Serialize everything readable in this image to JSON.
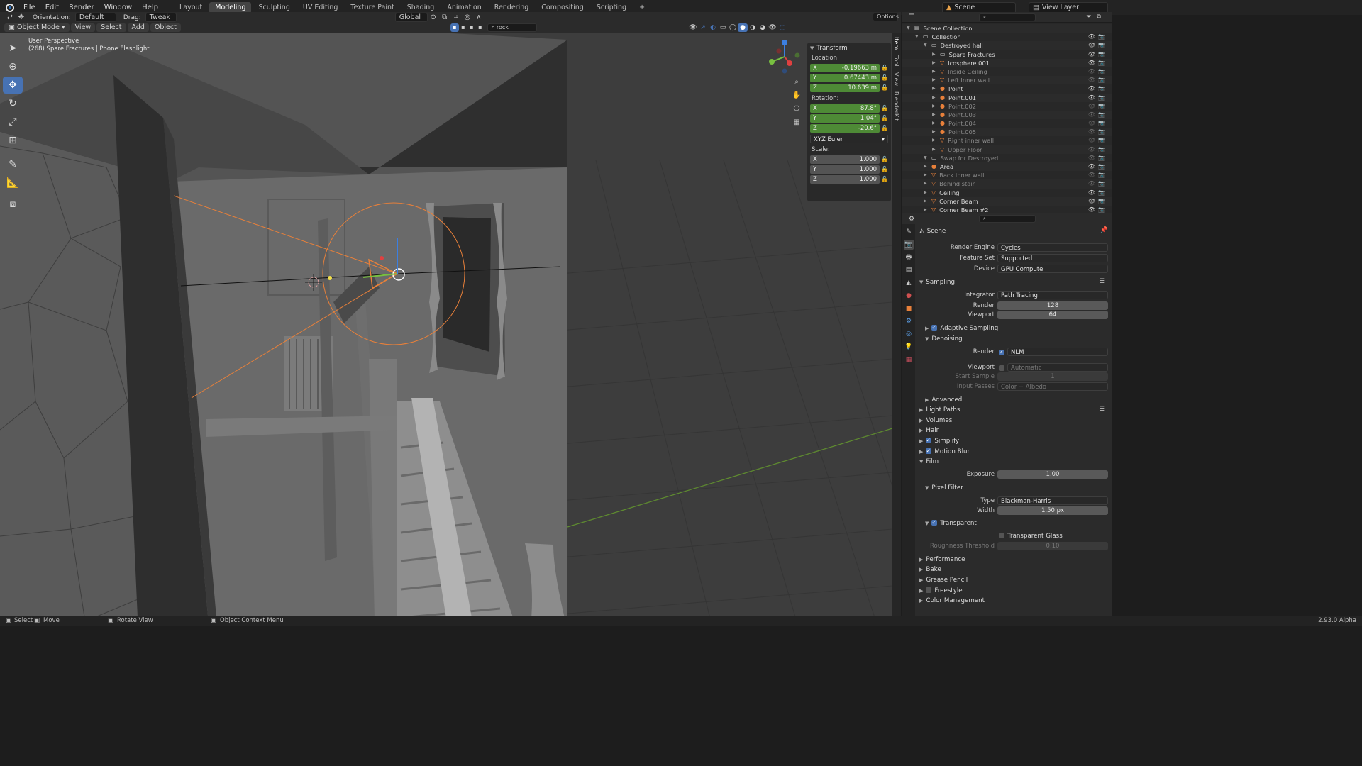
{
  "menu": [
    "File",
    "Edit",
    "Render",
    "Window",
    "Help"
  ],
  "workspaces": [
    "Layout",
    "Modeling",
    "Sculpting",
    "UV Editing",
    "Texture Paint",
    "Shading",
    "Animation",
    "Rendering",
    "Compositing",
    "Scripting"
  ],
  "active_workspace": "Modeling",
  "scene_name": "Scene",
  "view_layer": "View Layer",
  "tool_header": {
    "orientation_label": "Orientation:",
    "orientation_value": "Default",
    "drag_label": "Drag:",
    "drag_value": "Tweak",
    "transform_orientation": "Global",
    "options": "Options"
  },
  "viewport_header": {
    "mode": "Object Mode",
    "menus": [
      "View",
      "Select",
      "Add",
      "Object"
    ],
    "search_value": "rock"
  },
  "viewport": {
    "perspective": "User Perspective",
    "info": "(268) Spare Fractures | Phone Flashlight"
  },
  "npanel": {
    "title": "Transform",
    "location_label": "Location:",
    "location": [
      {
        "axis": "X",
        "value": "-0.19663 m"
      },
      {
        "axis": "Y",
        "value": "0.67443 m"
      },
      {
        "axis": "Z",
        "value": "10.639 m"
      }
    ],
    "rotation_label": "Rotation:",
    "rotation": [
      {
        "axis": "X",
        "value": "87.8°"
      },
      {
        "axis": "Y",
        "value": "1.04°"
      },
      {
        "axis": "Z",
        "value": "-20.6°"
      }
    ],
    "rotation_mode": "XYZ Euler",
    "scale_label": "Scale:",
    "scale": [
      {
        "axis": "X",
        "value": "1.000"
      },
      {
        "axis": "Y",
        "value": "1.000"
      },
      {
        "axis": "Z",
        "value": "1.000"
      }
    ],
    "tabs": [
      "Item",
      "Tool",
      "View",
      "BlenderKit"
    ]
  },
  "outliner": {
    "rows": [
      {
        "name": "Scene Collection",
        "indent": 0,
        "type": "scene",
        "dim": false
      },
      {
        "name": "Collection",
        "indent": 1,
        "type": "collection",
        "dim": false
      },
      {
        "name": "Destroyed hall",
        "indent": 2,
        "type": "collection",
        "dim": false
      },
      {
        "name": "Spare Fractures",
        "indent": 3,
        "type": "collection",
        "dim": false
      },
      {
        "name": "Icosphere.001",
        "indent": 3,
        "type": "mesh",
        "dim": false
      },
      {
        "name": "Inside Ceiling",
        "indent": 3,
        "type": "mesh",
        "dim": true
      },
      {
        "name": "Left Inner wall",
        "indent": 3,
        "type": "mesh",
        "dim": true
      },
      {
        "name": "Point",
        "indent": 3,
        "type": "light",
        "dim": false
      },
      {
        "name": "Point.001",
        "indent": 3,
        "type": "light",
        "dim": false
      },
      {
        "name": "Point.002",
        "indent": 3,
        "type": "light",
        "dim": true
      },
      {
        "name": "Point.003",
        "indent": 3,
        "type": "light",
        "dim": true
      },
      {
        "name": "Point.004",
        "indent": 3,
        "type": "light",
        "dim": true
      },
      {
        "name": "Point.005",
        "indent": 3,
        "type": "light",
        "dim": true
      },
      {
        "name": "Right inner wall",
        "indent": 3,
        "type": "mesh",
        "dim": true
      },
      {
        "name": "Upper Floor",
        "indent": 3,
        "type": "mesh",
        "dim": true
      },
      {
        "name": "Swap for Destroyed",
        "indent": 2,
        "type": "collection",
        "dim": true
      },
      {
        "name": "Area",
        "indent": 2,
        "type": "light",
        "dim": false
      },
      {
        "name": "Back inner wall",
        "indent": 2,
        "type": "mesh",
        "dim": true
      },
      {
        "name": "Behind stair",
        "indent": 2,
        "type": "mesh",
        "dim": true
      },
      {
        "name": "Ceiling",
        "indent": 2,
        "type": "mesh",
        "dim": false
      },
      {
        "name": "Corner Beam",
        "indent": 2,
        "type": "mesh",
        "dim": false
      },
      {
        "name": "Corner Beam #2",
        "indent": 2,
        "type": "mesh",
        "dim": false
      }
    ]
  },
  "properties": {
    "context": "Scene",
    "render_engine_label": "Render Engine",
    "render_engine": "Cycles",
    "feature_set_label": "Feature Set",
    "feature_set": "Supported",
    "device_label": "Device",
    "device": "GPU Compute",
    "sampling": "Sampling",
    "integrator_label": "Integrator",
    "integrator": "Path Tracing",
    "render_label": "Render",
    "render_samples": "128",
    "viewport_label": "Viewport",
    "viewport_samples": "64",
    "adaptive_sampling": "Adaptive Sampling",
    "denoising": "Denoising",
    "denoise_render_label": "Render",
    "denoise_render": "NLM",
    "denoise_viewport_label": "Viewport",
    "denoise_viewport": "Automatic",
    "start_sample_label": "Start Sample",
    "start_sample": "1",
    "input_passes_label": "Input Passes",
    "input_passes": "Color + Albedo",
    "advanced": "Advanced",
    "light_paths": "Light Paths",
    "volumes": "Volumes",
    "hair": "Hair",
    "simplify": "Simplify",
    "motion_blur": "Motion Blur",
    "film": "Film",
    "exposure_label": "Exposure",
    "exposure": "1.00",
    "pixel_filter": "Pixel Filter",
    "type_label": "Type",
    "filter_type": "Blackman-Harris",
    "width_label": "Width",
    "filter_width": "1.50 px",
    "transparent": "Transparent",
    "transparent_glass": "Transparent Glass",
    "roughness_threshold_label": "Roughness Threshold",
    "roughness_threshold": "0.10",
    "performance": "Performance",
    "bake": "Bake",
    "grease_pencil": "Grease Pencil",
    "freestyle": "Freestyle",
    "color_management": "Color Management"
  },
  "statusbar": {
    "select": "Select",
    "move": "Move",
    "rotate_view": "Rotate View",
    "context_menu": "Object Context Menu",
    "version": "2.93.0 Alpha"
  },
  "colors": {
    "accent": "#4772b3",
    "viewport_bg": "#3d3d3d",
    "selection_orange": "#e8803a",
    "field_green": "#4e8a36"
  }
}
